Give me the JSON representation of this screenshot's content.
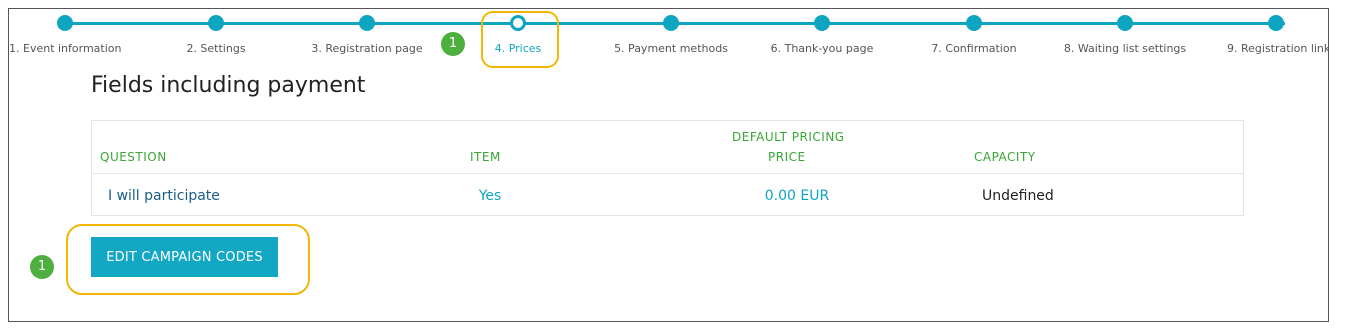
{
  "wizard": {
    "steps": [
      {
        "label": "1. Event information"
      },
      {
        "label": "2. Settings"
      },
      {
        "label": "3. Registration page"
      },
      {
        "label": "4. Prices"
      },
      {
        "label": "5. Payment methods"
      },
      {
        "label": "6. Thank-you page"
      },
      {
        "label": "7. Confirmation"
      },
      {
        "label": "8. Waiting list settings"
      },
      {
        "label": "9. Registration link"
      }
    ],
    "current_step": 4
  },
  "annotations": {
    "badge_top": "1",
    "badge_bottom": "1",
    "highlight_color": "#f2b705",
    "badge_color": "#4caf3e"
  },
  "section": {
    "title": "Fields including payment"
  },
  "table": {
    "headers": {
      "question": "QUESTION",
      "item": "ITEM",
      "default_pricing": "DEFAULT PRICING",
      "price": "PRICE",
      "capacity": "CAPACITY"
    },
    "rows": [
      {
        "question": "I will participate",
        "item": "Yes",
        "price": "0.00 EUR",
        "capacity": "Undefined"
      }
    ]
  },
  "actions": {
    "edit_campaign_codes": "EDIT CAMPAIGN CODES"
  },
  "colors": {
    "accent": "#0ea5c0",
    "header_green": "#3aa635",
    "button": "#12a8c4"
  }
}
